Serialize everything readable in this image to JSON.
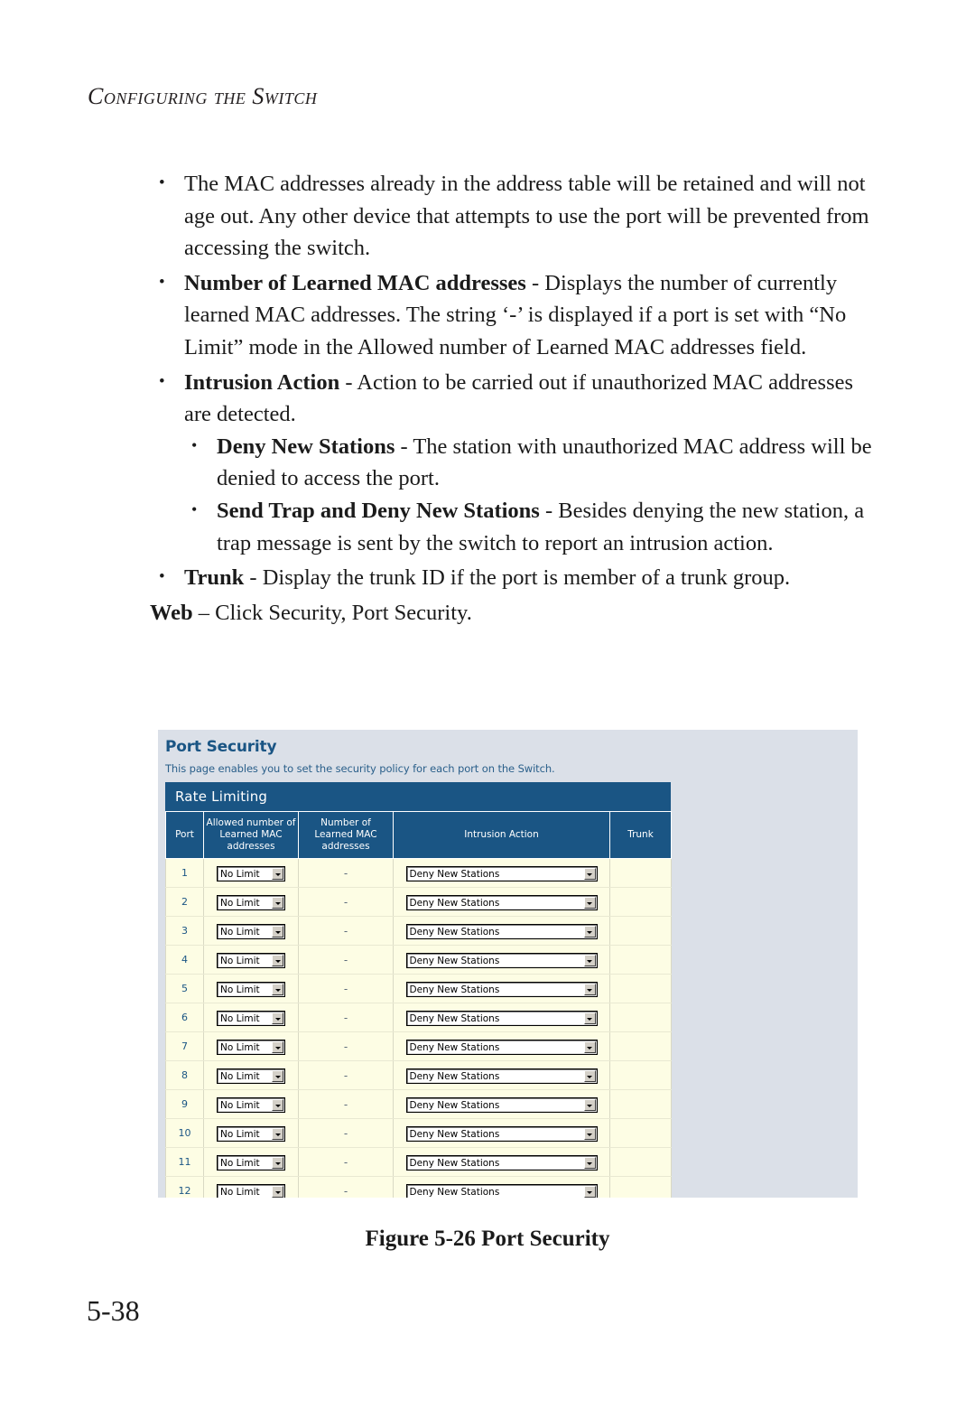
{
  "page": {
    "running_head": "Configuring the Switch",
    "folio": "5-38"
  },
  "body": {
    "bullets": [
      {
        "term": "",
        "text": "The MAC addresses already in the address table will be retained and will not age out. Any other device that attempts to use the port will be prevented from accessing the switch."
      },
      {
        "term": "Number of Learned MAC addresses",
        "text": " - Displays the number of currently learned MAC addresses. The string ‘-’ is displayed if a port is set with “No Limit” mode in the Allowed number of Learned MAC addresses field."
      },
      {
        "term": "Intrusion Action",
        "text": " - Action to be carried out if unauthorized MAC addresses are detected.",
        "sub": [
          {
            "term": "Deny New Stations",
            "text": " - The station with unauthorized MAC address will be denied to access the port."
          },
          {
            "term": "Send Trap and Deny New Stations",
            "text": " - Besides denying the new station, a trap message is sent by the switch to report an intrusion action."
          }
        ]
      },
      {
        "term": "Trunk",
        "text": " - Display the trunk ID if the port is member of a trunk group."
      }
    ],
    "web_line_term": "Web",
    "web_line_text": " – Click Security, Port Security."
  },
  "screenshot": {
    "title": "Port Security",
    "subtitle": "This page enables you to set the security policy for each port on the Switch.",
    "section_bar": "Rate Limiting",
    "columns": [
      "Port",
      "Allowed number of Learned MAC addresses",
      "Number of Learned MAC addresses",
      "Intrusion Action",
      "Trunk"
    ],
    "rows": [
      {
        "port": "1",
        "allowed": "No Limit",
        "learned": "-",
        "action": "Deny New Stations",
        "trunk": ""
      },
      {
        "port": "2",
        "allowed": "No Limit",
        "learned": "-",
        "action": "Deny New Stations",
        "trunk": ""
      },
      {
        "port": "3",
        "allowed": "No Limit",
        "learned": "-",
        "action": "Deny New Stations",
        "trunk": ""
      },
      {
        "port": "4",
        "allowed": "No Limit",
        "learned": "-",
        "action": "Deny New Stations",
        "trunk": ""
      },
      {
        "port": "5",
        "allowed": "No Limit",
        "learned": "-",
        "action": "Deny New Stations",
        "trunk": ""
      },
      {
        "port": "6",
        "allowed": "No Limit",
        "learned": "-",
        "action": "Deny New Stations",
        "trunk": ""
      },
      {
        "port": "7",
        "allowed": "No Limit",
        "learned": "-",
        "action": "Deny New Stations",
        "trunk": ""
      },
      {
        "port": "8",
        "allowed": "No Limit",
        "learned": "-",
        "action": "Deny New Stations",
        "trunk": ""
      },
      {
        "port": "9",
        "allowed": "No Limit",
        "learned": "-",
        "action": "Deny New Stations",
        "trunk": ""
      },
      {
        "port": "10",
        "allowed": "No Limit",
        "learned": "-",
        "action": "Deny New Stations",
        "trunk": ""
      },
      {
        "port": "11",
        "allowed": "No Limit",
        "learned": "-",
        "action": "Deny New Stations",
        "trunk": ""
      },
      {
        "port": "12",
        "allowed": "No Limit",
        "learned": "-",
        "action": "Deny New Stations",
        "trunk": ""
      }
    ],
    "colors": {
      "panel_background": "#dbe0e8",
      "header_blue": "#1a5584",
      "row_cream": "#fdfde4"
    }
  },
  "caption": "Figure 5-26  Port Security"
}
